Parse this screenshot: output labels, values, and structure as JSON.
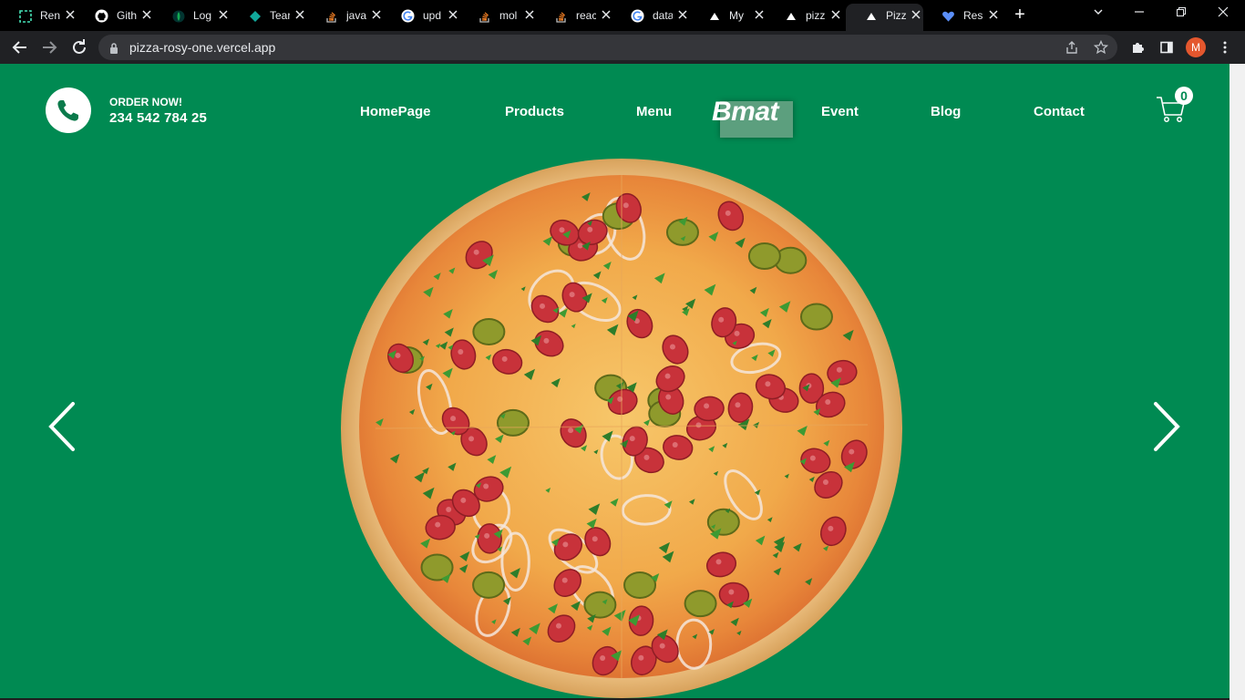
{
  "browser": {
    "tabs": [
      {
        "label": "Ren",
        "icon": "render-icon"
      },
      {
        "label": "Gith",
        "icon": "github-icon"
      },
      {
        "label": "Log",
        "icon": "mongodb-leaf-icon"
      },
      {
        "label": "Tear",
        "icon": "teams-diamond-icon"
      },
      {
        "label": "java",
        "icon": "stackoverflow-icon"
      },
      {
        "label": "upd",
        "icon": "google-icon"
      },
      {
        "label": "mol",
        "icon": "stackoverflow-icon"
      },
      {
        "label": "reac",
        "icon": "stackoverflow-icon"
      },
      {
        "label": "data",
        "icon": "google-icon"
      },
      {
        "label": "My",
        "icon": "vercel-triangle-icon"
      },
      {
        "label": "pizz",
        "icon": "vercel-triangle-icon"
      },
      {
        "label": "Pizz",
        "icon": "vercel-triangle-icon",
        "active": true
      },
      {
        "label": "Res",
        "icon": "heart-icon"
      }
    ],
    "url": "pizza-rosy-one.vercel.app",
    "profile_initial": "M"
  },
  "header": {
    "order_label": "ORDER NOW!",
    "phone_number": "234 542 784 25",
    "nav": [
      "HomePage",
      "Products",
      "Menu",
      "Event",
      "Blog",
      "Contact"
    ],
    "logo": "Bmat",
    "cart_count": "0"
  },
  "colors": {
    "page_background": "#008a52",
    "accent": "#ffffff"
  }
}
